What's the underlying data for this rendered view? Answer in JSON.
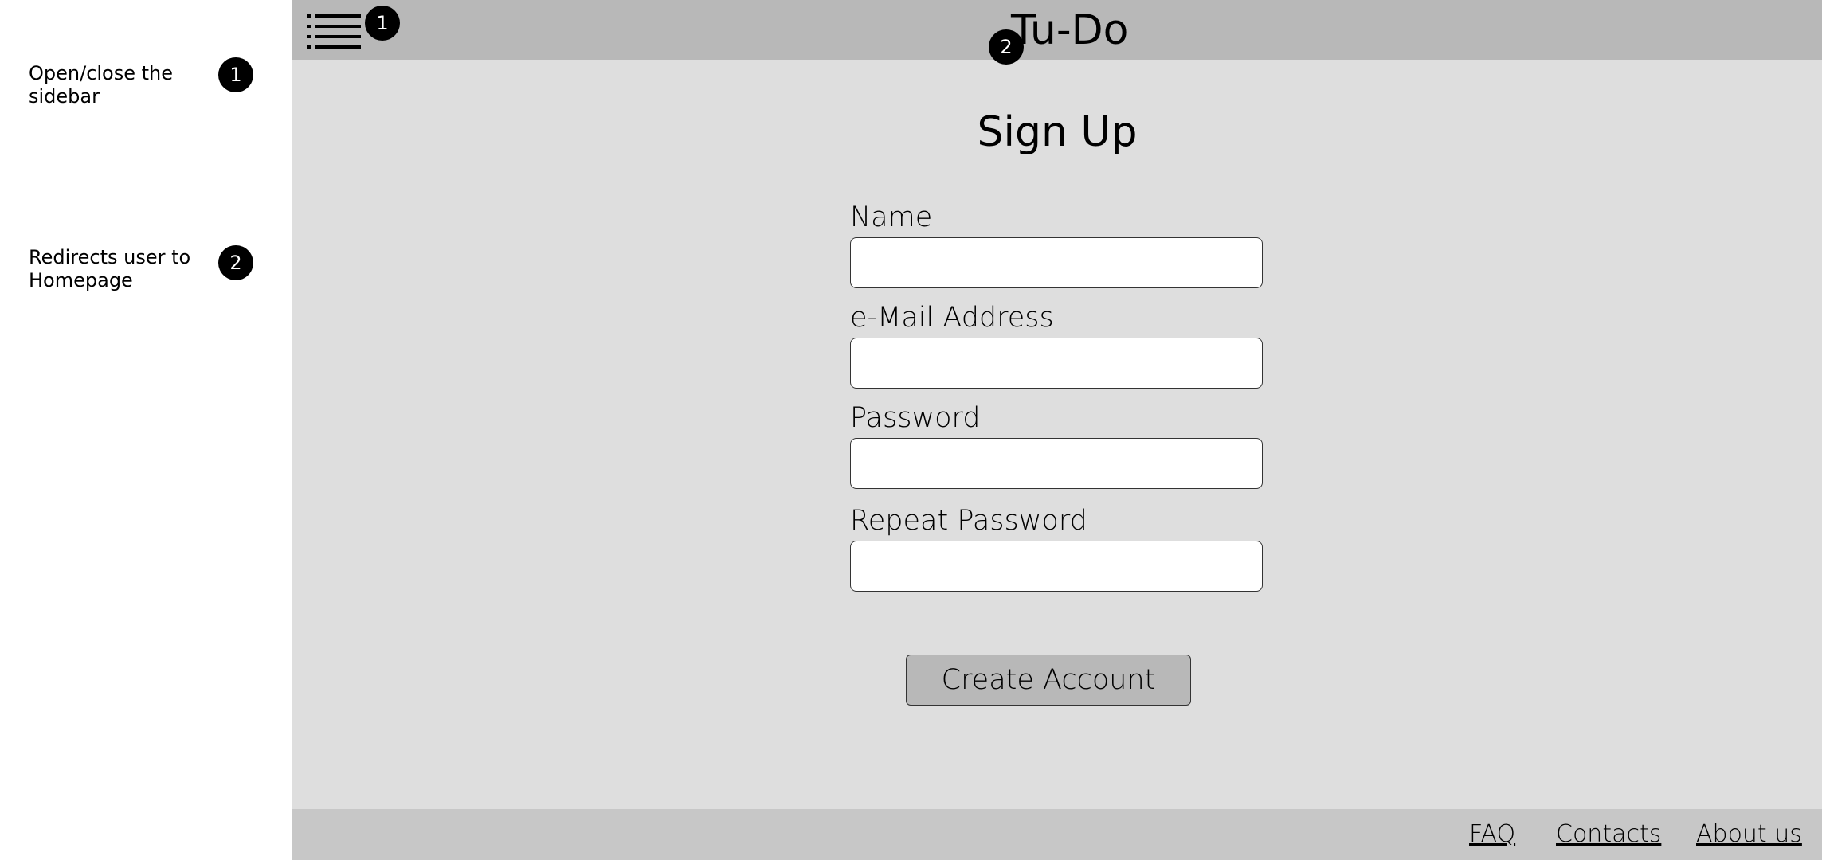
{
  "annotations": [
    {
      "number": "1",
      "text": "Open/close the sidebar"
    },
    {
      "number": "2",
      "text": "Redirects user to Homepage"
    }
  ],
  "header": {
    "menu_icon": "menu-list-icon",
    "title": "Tu-Do",
    "menu_badge": "1",
    "title_badge": "2"
  },
  "main": {
    "title": "Sign Up",
    "fields": [
      {
        "label": "Name",
        "value": "",
        "placeholder": ""
      },
      {
        "label": "e-Mail Address",
        "value": "",
        "placeholder": ""
      },
      {
        "label": "Password",
        "value": "",
        "placeholder": ""
      },
      {
        "label": "Repeat Password",
        "value": "",
        "placeholder": ""
      }
    ],
    "submit_label": "Create Account"
  },
  "footer": {
    "links": [
      "FAQ",
      "Contacts",
      "About us"
    ]
  },
  "colors": {
    "header_bg": "#b8b8b8",
    "content_bg": "#dedede",
    "footer_bg": "#c7c7c7",
    "button_bg": "#b8b8b8",
    "badge_bg": "#000000"
  }
}
